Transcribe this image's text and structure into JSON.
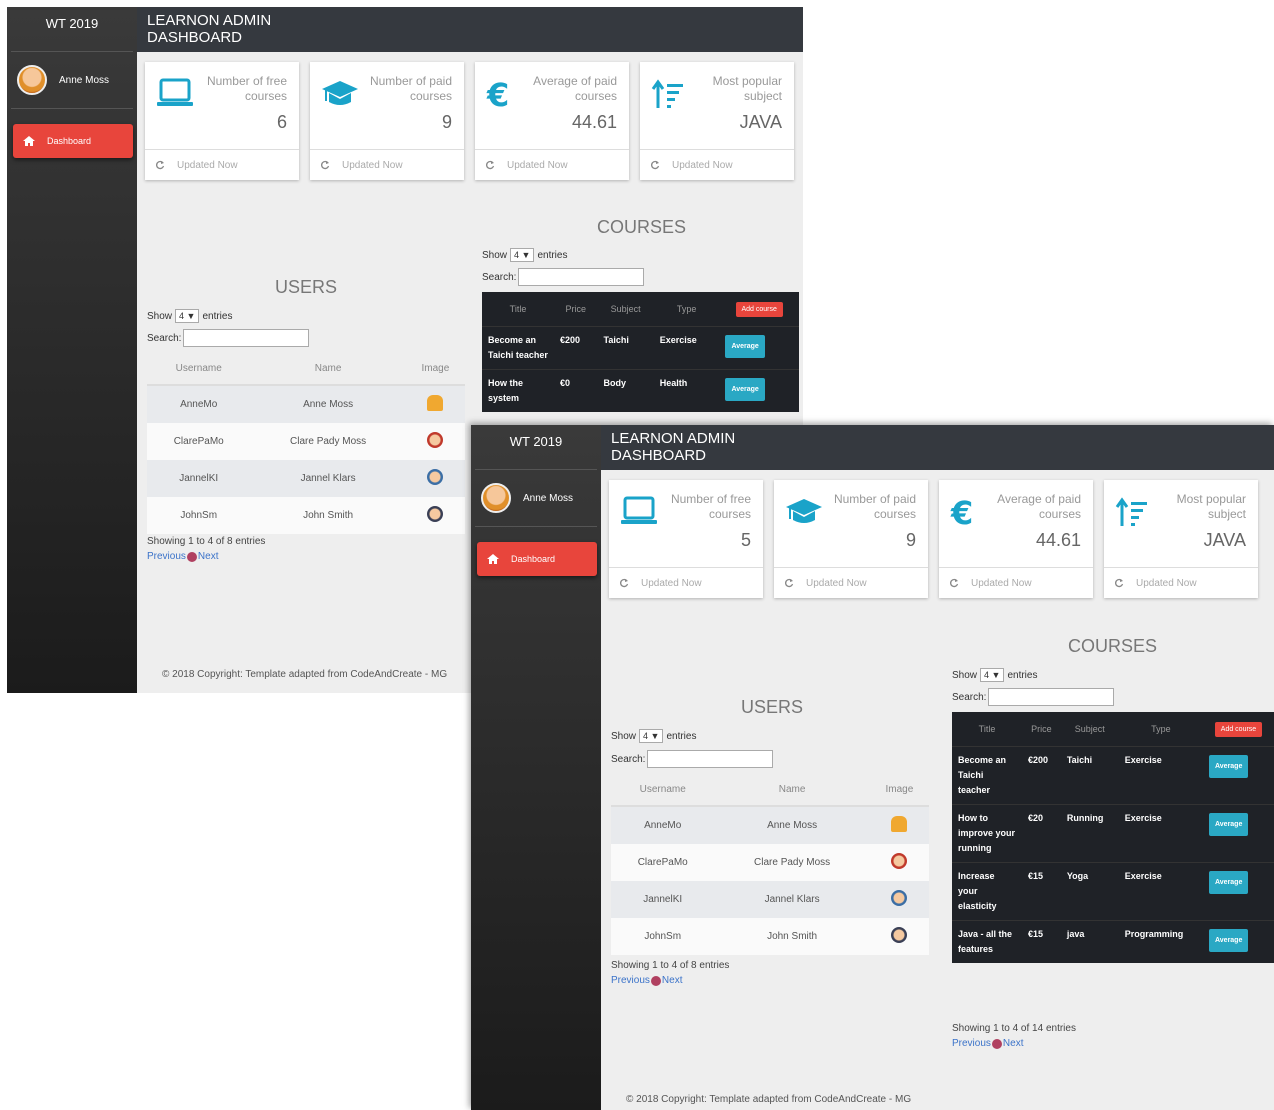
{
  "back": {
    "brand": "WT 2019",
    "user_name": "Anne Moss",
    "nav_dashboard": "Dashboard",
    "header_title_1": "LEARNON ADMIN",
    "header_title_2": "DASHBOARD",
    "cards": [
      {
        "title": "Number of free courses",
        "value": "6",
        "footer": "Updated Now",
        "icon": "laptop-icon"
      },
      {
        "title": "Number of paid courses",
        "value": "9",
        "footer": "Updated Now",
        "icon": "graduation-cap-icon"
      },
      {
        "title": "Average of paid courses",
        "value": "44.61",
        "footer": "Updated Now",
        "icon": "euro-icon"
      },
      {
        "title": "Most popular subject",
        "value": "JAVA",
        "footer": "Updated Now",
        "icon": "sort-icon"
      }
    ],
    "users": {
      "title": "USERS",
      "show": "Show",
      "entries_value": "4",
      "entries": "entries",
      "search": "Search:",
      "headers": [
        "Username",
        "Name",
        "Image"
      ],
      "rows": [
        {
          "username": "AnneMo",
          "name": "Anne Moss"
        },
        {
          "username": "ClarePaMo",
          "name": "Clare Pady Moss"
        },
        {
          "username": "JannelKI",
          "name": "Jannel Klars"
        },
        {
          "username": "JohnSm",
          "name": "John Smith"
        }
      ],
      "info": "Showing 1 to 4 of 8 entries",
      "prev": "Previous",
      "next": "Next"
    },
    "courses": {
      "title": "COURSES",
      "show": "Show",
      "entries_value": "4",
      "entries": "entries",
      "search": "Search:",
      "headers": [
        "Title",
        "Price",
        "Subject",
        "Type"
      ],
      "head_button": "Add course",
      "rows": [
        {
          "title": "Become an Taichi teacher",
          "price": "€200",
          "subject": "Taichi",
          "type": "Exercise",
          "button": "Average"
        },
        {
          "title": "How the system",
          "price": "€0",
          "subject": "Body",
          "type": "Health",
          "button": "Average"
        }
      ]
    },
    "footer": "© 2018 Copyright: Template adapted from CodeAndCreate - MG"
  },
  "front": {
    "brand": "WT 2019",
    "user_name": "Anne Moss",
    "nav_dashboard": "Dashboard",
    "header_title_1": "LEARNON ADMIN",
    "header_title_2": "DASHBOARD",
    "cards": [
      {
        "title": "Number of free courses",
        "value": "5",
        "footer": "Updated Now",
        "icon": "laptop-icon"
      },
      {
        "title": "Number of paid courses",
        "value": "9",
        "footer": "Updated Now",
        "icon": "graduation-cap-icon"
      },
      {
        "title": "Average of paid courses",
        "value": "44.61",
        "footer": "Updated Now",
        "icon": "euro-icon"
      },
      {
        "title": "Most popular subject",
        "value": "JAVA",
        "footer": "Updated Now",
        "icon": "sort-icon"
      }
    ],
    "users": {
      "title": "USERS",
      "show": "Show",
      "entries_value": "4",
      "entries": "entries",
      "search": "Search:",
      "headers": [
        "Username",
        "Name",
        "Image"
      ],
      "rows": [
        {
          "username": "AnneMo",
          "name": "Anne Moss"
        },
        {
          "username": "ClarePaMo",
          "name": "Clare Pady Moss"
        },
        {
          "username": "JannelKI",
          "name": "Jannel Klars"
        },
        {
          "username": "JohnSm",
          "name": "John Smith"
        }
      ],
      "info": "Showing 1 to 4 of 8 entries",
      "prev": "Previous",
      "next": "Next"
    },
    "courses": {
      "title": "COURSES",
      "show": "Show",
      "entries_value": "4",
      "entries": "entries",
      "search": "Search:",
      "headers": [
        "Title",
        "Price",
        "Subject",
        "Type"
      ],
      "head_button": "Add course",
      "rows": [
        {
          "title": "Become an Taichi teacher",
          "price": "€200",
          "subject": "Taichi",
          "type": "Exercise",
          "button": "Average"
        },
        {
          "title": "How to improve your running",
          "price": "€20",
          "subject": "Running",
          "type": "Exercise",
          "button": "Average"
        },
        {
          "title": "Increase your elasticity",
          "price": "€15",
          "subject": "Yoga",
          "type": "Exercise",
          "button": "Average"
        },
        {
          "title": "Java - all the features",
          "price": "€15",
          "subject": "java",
          "type": "Programming",
          "button": "Average"
        }
      ],
      "info": "Showing 1 to 4 of 14 entries",
      "prev": "Previous",
      "next": "Next"
    },
    "footer": "© 2018 Copyright: Template adapted from CodeAndCreate - MG"
  },
  "colors": {
    "accent_red": "#e8453c",
    "accent_teal": "#2aa8c4",
    "sidebar": "#2b2b2b",
    "topbar": "#35393f"
  }
}
